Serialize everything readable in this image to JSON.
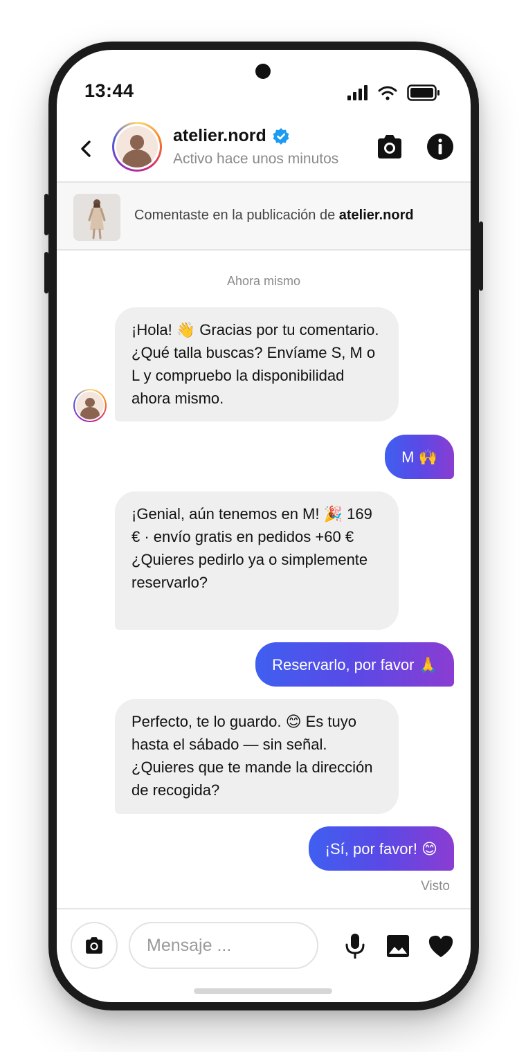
{
  "status_bar": {
    "time": "13:44",
    "icons": [
      "signal-icon",
      "wifi-icon",
      "battery-icon"
    ]
  },
  "header": {
    "username": "atelier.nord",
    "verified": true,
    "activity": "Activo hace unos minutos",
    "icons": [
      "back-icon",
      "camera-icon",
      "info-icon"
    ]
  },
  "post_context": {
    "prefix": "Comentaste en la publicación de",
    "account": "atelier.nord"
  },
  "conversation": {
    "timestamp": "Ahora mismo",
    "messages": [
      {
        "from": "atelier.nord",
        "text": "¡Hola! 👋 Gracias por tu comentario. ¿Qué talla buscas? Envíame S, M o L y compruebo la disponibilidad ahora mismo."
      },
      {
        "from": "me",
        "text": "M 🙌"
      },
      {
        "from": "atelier.nord",
        "text": "¡Genial, aún tenemos en M! 🎉 169 € · envío gratis en pedidos +60 € ¿Quieres pedirlo ya o simplemente reservarlo?"
      },
      {
        "from": "me",
        "text": "Reservarlo, por favor 🙏"
      },
      {
        "from": "atelier.nord",
        "text": "Perfecto, te lo guardo. 😊 Es tuyo hasta el sábado — sin señal. ¿Quieres que te mande la dirección de recogida?"
      },
      {
        "from": "me",
        "text": "¡Sí, por favor! 😊"
      }
    ],
    "seen_label": "Visto"
  },
  "composer": {
    "placeholder": "Mensaje ...",
    "icons": [
      "camera-icon",
      "microphone-icon",
      "image-icon",
      "heart-icon"
    ]
  },
  "colors": {
    "outgoing_gradient": [
      "#3f5ff0",
      "#8a3dd2"
    ],
    "incoming_bubble": "#efefef",
    "verified_badge": "#1d9bf0"
  }
}
